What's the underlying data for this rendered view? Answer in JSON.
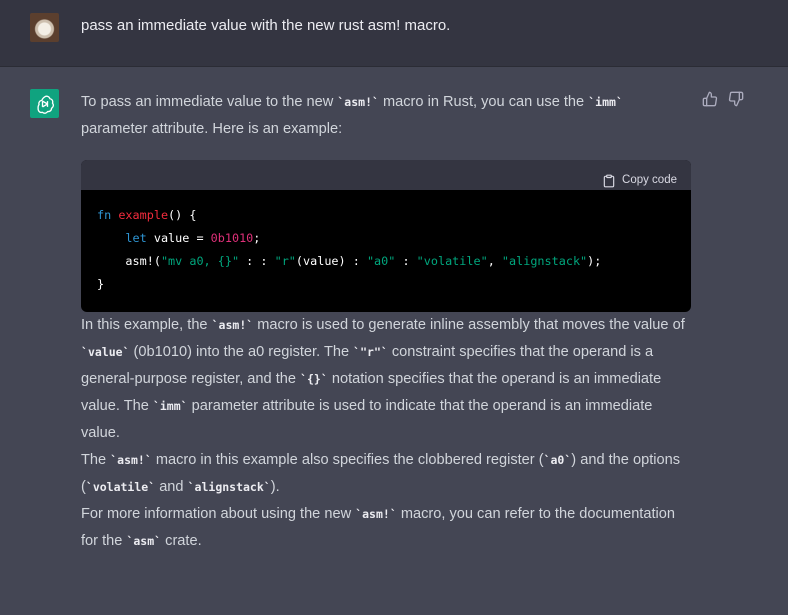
{
  "user": {
    "message": "pass an immediate value with the new  rust asm! macro."
  },
  "assistant": {
    "intro": {
      "t1": "To pass an immediate value to the new ",
      "c1": "asm!",
      "t2": " macro in Rust, you can use the ",
      "c2": "imm",
      "t3": " parameter attribute. Here is an example:"
    },
    "code": {
      "copy_label": "Copy code",
      "l1_kw": "fn",
      "l1_name": "example",
      "l1_rest": "() {",
      "l2_kw": "let",
      "l2_mid": " value = ",
      "l2_num": "0b1010",
      "l2_end": ";",
      "l3_a": "asm!(",
      "l3_s1": "\"mv a0, {}\"",
      "l3_b": " : : ",
      "l3_s2": "\"r\"",
      "l3_c": "(value) : ",
      "l3_s3": "\"a0\"",
      "l3_d": " : ",
      "l3_s4": "\"volatile\"",
      "l3_e": ", ",
      "l3_s5": "\"alignstack\"",
      "l3_f": ");",
      "l4": "}"
    },
    "p2": {
      "t1": "In this example, the ",
      "c1": "asm!",
      "t2": " macro is used to generate inline assembly that moves the value of ",
      "c2": "value",
      "t3": " (0b1010) into the a0 register. The ",
      "c3": "\"r\"",
      "t4": " constraint specifies that the operand is a general-purpose register, and the ",
      "c4": "{}",
      "t5": " notation specifies that the operand is an immediate value. The ",
      "c5": "imm",
      "t6": " parameter attribute is used to indicate that the operand is an immediate value."
    },
    "p3": {
      "t1": "The ",
      "c1": "asm!",
      "t2": " macro in this example also specifies the clobbered register (",
      "c2": "a0",
      "t3": ") and the options (",
      "c3": "volatile",
      "t4": " and ",
      "c4": "alignstack",
      "t5": ")."
    },
    "p4": {
      "t1": "For more information about using the new ",
      "c1": "asm!",
      "t2": " macro, you can refer to the documentation for the ",
      "c2": "asm",
      "t3": " crate."
    }
  },
  "icons": {
    "user_avatar": "user-avatar-icon",
    "bot_avatar": "openai-logo-icon",
    "thumbs_up": "thumbs-up-icon",
    "thumbs_down": "thumbs-down-icon",
    "clipboard": "clipboard-icon"
  },
  "colors": {
    "user_bg": "#343541",
    "assistant_bg": "#444654",
    "brand": "#10a37f",
    "code_bg": "#000000"
  }
}
